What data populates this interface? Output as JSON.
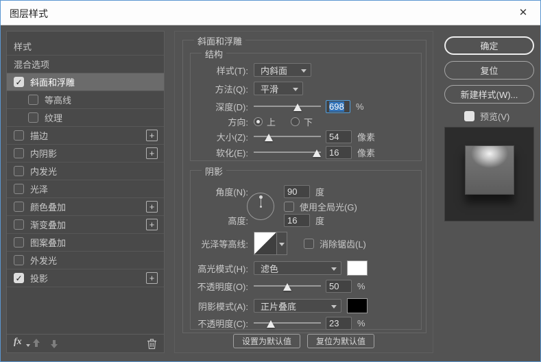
{
  "window": {
    "title": "图层样式"
  },
  "icons": {
    "close": "✕",
    "check": "✓",
    "plus": "+",
    "fx": "fx"
  },
  "colors": {
    "selection_blue": "#3273b8",
    "highlight_swatch": "#ffffff",
    "shadow_swatch": "#000000"
  },
  "sidebar": {
    "items": [
      {
        "label": "样式",
        "checkbox": false,
        "checked": false,
        "indent": false,
        "plus": false,
        "selected": false
      },
      {
        "label": "混合选项",
        "checkbox": false,
        "checked": false,
        "indent": false,
        "plus": false,
        "selected": false
      },
      {
        "label": "斜面和浮雕",
        "checkbox": true,
        "checked": true,
        "indent": false,
        "plus": false,
        "selected": true
      },
      {
        "label": "等高线",
        "checkbox": true,
        "checked": false,
        "indent": true,
        "plus": false,
        "selected": false
      },
      {
        "label": "纹理",
        "checkbox": true,
        "checked": false,
        "indent": true,
        "plus": false,
        "selected": false
      },
      {
        "label": "描边",
        "checkbox": true,
        "checked": false,
        "indent": false,
        "plus": true,
        "selected": false
      },
      {
        "label": "内阴影",
        "checkbox": true,
        "checked": false,
        "indent": false,
        "plus": true,
        "selected": false
      },
      {
        "label": "内发光",
        "checkbox": true,
        "checked": false,
        "indent": false,
        "plus": false,
        "selected": false
      },
      {
        "label": "光泽",
        "checkbox": true,
        "checked": false,
        "indent": false,
        "plus": false,
        "selected": false
      },
      {
        "label": "颜色叠加",
        "checkbox": true,
        "checked": false,
        "indent": false,
        "plus": true,
        "selected": false
      },
      {
        "label": "渐变叠加",
        "checkbox": true,
        "checked": false,
        "indent": false,
        "plus": true,
        "selected": false
      },
      {
        "label": "图案叠加",
        "checkbox": true,
        "checked": false,
        "indent": false,
        "plus": false,
        "selected": false
      },
      {
        "label": "外发光",
        "checkbox": true,
        "checked": false,
        "indent": false,
        "plus": false,
        "selected": false
      },
      {
        "label": "投影",
        "checkbox": true,
        "checked": true,
        "indent": false,
        "plus": true,
        "selected": false
      }
    ]
  },
  "main": {
    "section_title": "斜面和浮雕",
    "structure": {
      "legend": "结构",
      "style_label": "样式(T):",
      "style_value": "内斜面",
      "method_label": "方法(Q):",
      "method_value": "平滑",
      "depth_label": "深度(D):",
      "depth_value": "698",
      "depth_unit": "%",
      "depth_pct": 65,
      "direction_label": "方向:",
      "dir_up": "上",
      "dir_down": "下",
      "size_label": "大小(Z):",
      "size_value": "54",
      "size_unit": "像素",
      "size_pct": 22,
      "soften_label": "软化(E):",
      "soften_value": "16",
      "soften_unit": "像素",
      "soften_pct": 94
    },
    "shading": {
      "legend": "阴影",
      "angle_label": "角度(N):",
      "angle_value": "90",
      "angle_unit": "度",
      "global_light_label": "使用全局光(G)",
      "altitude_label": "高度:",
      "altitude_value": "16",
      "altitude_unit": "度",
      "gloss_contour_label": "光泽等高线:",
      "anti_alias_label": "消除锯齿(L)",
      "highlight_mode_label": "高光模式(H):",
      "highlight_mode_value": "滤色",
      "opacity1_label": "不透明度(O):",
      "opacity1_value": "50",
      "opacity1_unit": "%",
      "opacity1_pct": 50,
      "shadow_mode_label": "阴影模式(A):",
      "shadow_mode_value": "正片叠底",
      "opacity2_label": "不透明度(C):",
      "opacity2_value": "23",
      "opacity2_unit": "%",
      "opacity2_pct": 26
    },
    "buttons": {
      "set_default": "设置为默认值",
      "reset_default": "复位为默认值"
    }
  },
  "right": {
    "ok_label": "确定",
    "reset_label": "复位",
    "new_style_label": "新建样式(W)...",
    "preview_label": "预览(V)"
  }
}
